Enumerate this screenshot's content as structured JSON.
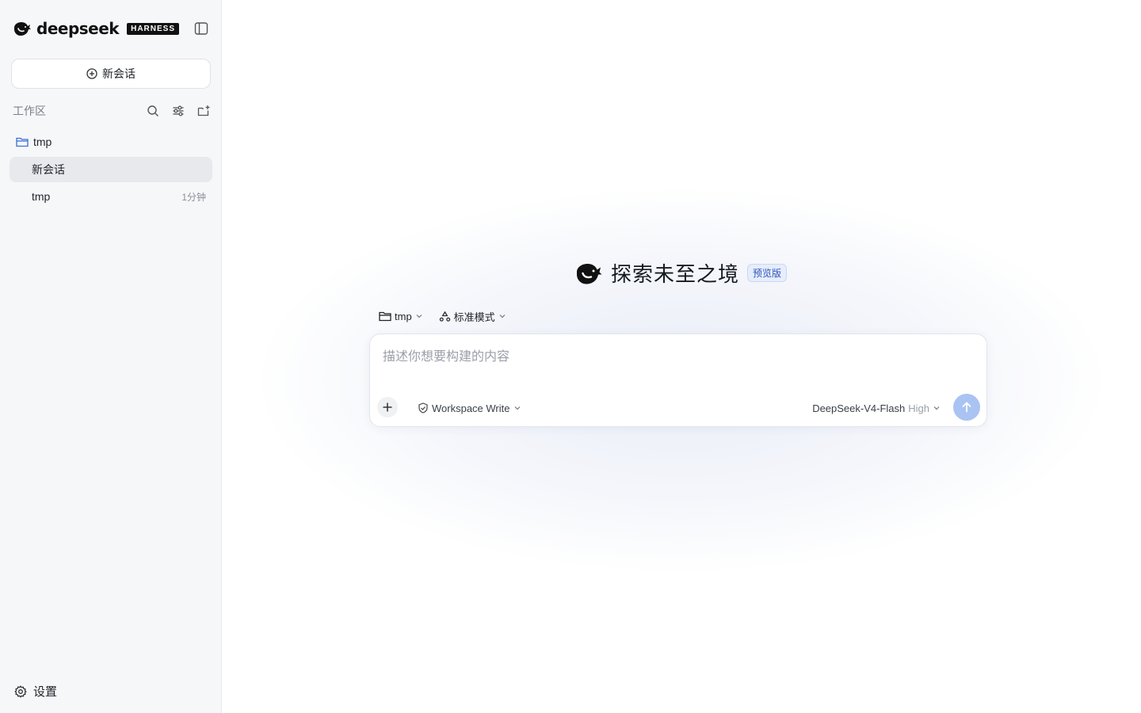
{
  "sidebar": {
    "brand_name": "deepseek",
    "brand_tag": "HARNESS",
    "new_chat_label": "新会话",
    "workspace_title": "工作区",
    "folder": {
      "name": "tmp",
      "icon": "folder-icon",
      "color": "#3b6fd8"
    },
    "sessions": [
      {
        "title": "新会话",
        "time": "",
        "active": true
      },
      {
        "title": "tmp",
        "time": "1分钟",
        "active": false
      }
    ],
    "settings_label": "设置"
  },
  "main": {
    "hero_title": "探索未至之境",
    "hero_badge": "预览版",
    "folder_chip": "tmp",
    "mode_chip": "标准模式",
    "composer": {
      "placeholder": "描述你想要构建的内容",
      "value": "",
      "permission": "Workspace Write",
      "model": "DeepSeek-V4-Flash",
      "effort": "High"
    }
  },
  "colors": {
    "sidebar_bg": "#f6f7f9",
    "active_session_bg": "#e8e9ec",
    "send_button": "#a9c3f3",
    "badge_bg": "#e6edfb",
    "badge_text": "#2e55b8"
  }
}
